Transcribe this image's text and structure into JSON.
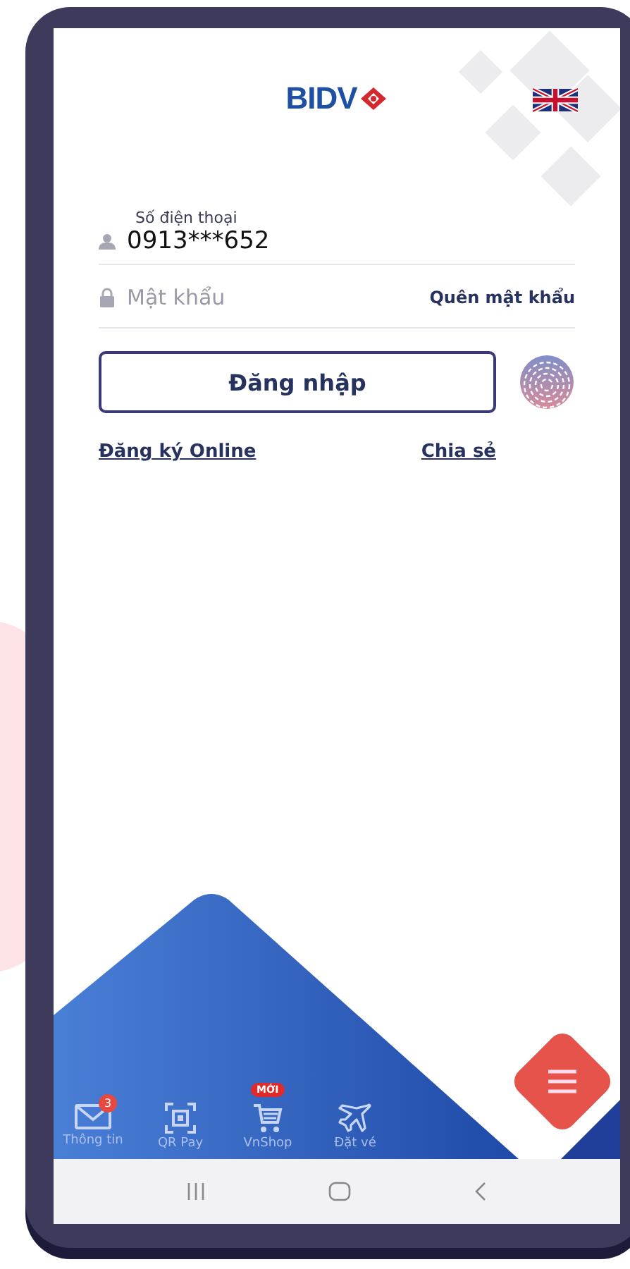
{
  "header": {
    "logo": "BIDV"
  },
  "phone_field": {
    "label": "Số điện thoại",
    "value": "0913***652"
  },
  "password_field": {
    "placeholder": "Mật khẩu"
  },
  "forgot_link": "Quên mật khẩu",
  "login_button": "Đăng nhập",
  "links": [
    "Đăng ký Online",
    "Chia sẻ"
  ],
  "shortcuts": [
    {
      "kind": "mail",
      "label": "Thông tin",
      "badge": {
        "kind": "count",
        "text": "3"
      }
    },
    {
      "kind": "qr",
      "label": "QR Pay"
    },
    {
      "kind": "cart",
      "label": "VnShop",
      "badge": {
        "kind": "tag",
        "text": "MỚI"
      }
    },
    {
      "kind": "plane",
      "label": "Đặt vé"
    }
  ]
}
